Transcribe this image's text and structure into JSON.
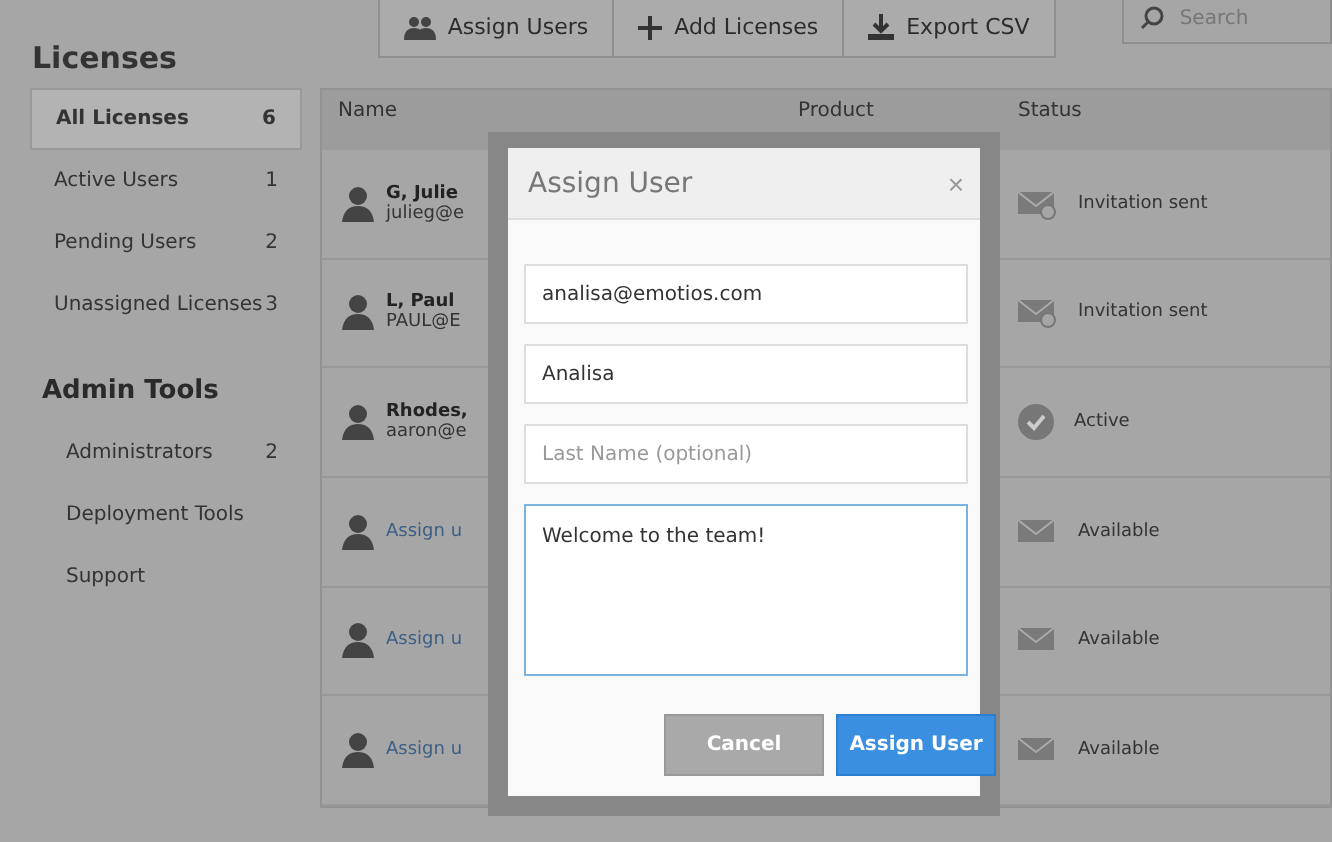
{
  "toolbar": {
    "buttons": [
      {
        "kind": "users",
        "label": "Assign Users"
      },
      {
        "kind": "add",
        "label": "Add Licenses"
      },
      {
        "kind": "export",
        "label": "Export CSV"
      }
    ],
    "search": {
      "placeholder": "Search"
    }
  },
  "page_title": "Licenses",
  "sidebar": {
    "items": [
      {
        "label": "All Licenses",
        "count": "6",
        "selected": true
      },
      {
        "label": "Active Users",
        "count": "1",
        "selected": false
      },
      {
        "label": "Pending Users",
        "count": "2",
        "selected": false
      },
      {
        "label": "Unassigned Licenses",
        "count": "3",
        "selected": false
      }
    ],
    "admin_title": "Admin Tools",
    "admin_items": [
      {
        "label": "Administrators",
        "count": "2"
      },
      {
        "label": "Deployment Tools"
      },
      {
        "label": "Support"
      }
    ]
  },
  "table": {
    "columns": [
      "Name",
      "Product",
      "Status"
    ],
    "rows": [
      {
        "kind": "pending",
        "name": "G, Julie",
        "email": "julieg@e",
        "status": "Invitation sent"
      },
      {
        "kind": "pending",
        "name": "L, Paul",
        "email": "PAUL@E",
        "status": "Invitation sent"
      },
      {
        "kind": "active",
        "name": "Rhodes,",
        "email": "aaron@e",
        "status": "Active"
      },
      {
        "kind": "available",
        "name": "Assign u",
        "status": "Available"
      },
      {
        "kind": "available",
        "name": "Assign u",
        "status": "Available"
      },
      {
        "kind": "available",
        "name": "Assign u",
        "status": "Available"
      }
    ]
  },
  "dialog": {
    "title": "Assign User",
    "close": "×",
    "fields": [
      {
        "kind": "input",
        "value": "analisa@emotios.com"
      },
      {
        "kind": "input",
        "value": "Analisa"
      },
      {
        "kind": "input",
        "placeholder": "Last Name (optional)"
      },
      {
        "kind": "textarea",
        "value": "Welcome to the team!",
        "focused": true
      }
    ],
    "buttons": [
      {
        "kind": "secondary",
        "label": "Cancel"
      },
      {
        "kind": "primary",
        "label": "Assign User"
      }
    ]
  }
}
